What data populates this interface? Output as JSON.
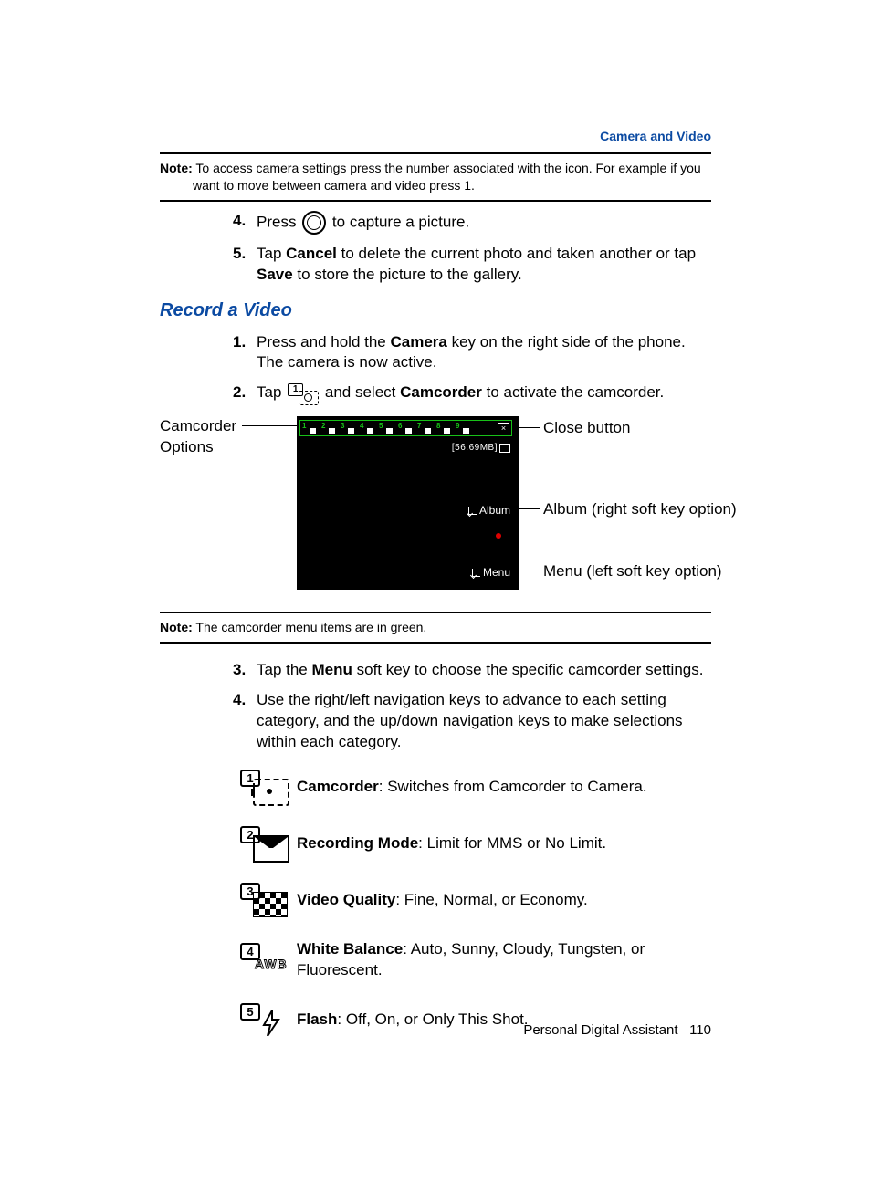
{
  "header": {
    "section": "Camera and Video"
  },
  "note1": {
    "label": "Note:",
    "text": "To access camera settings press the number associated with the icon. For example if you want to move between camera and video press 1."
  },
  "steps_a": {
    "s4": {
      "num": "4.",
      "pre": "Press ",
      "post": " to capture a picture."
    },
    "s5": {
      "num": "5.",
      "pre": "Tap ",
      "b1": "Cancel",
      "mid": " to delete the current photo and taken another or tap ",
      "b2": "Save",
      "post": " to store the picture to the gallery."
    }
  },
  "subhead": "Record a Video",
  "steps_b": {
    "s1": {
      "num": "1.",
      "pre": "Press and hold the ",
      "b1": "Camera",
      "post": " key on the right side of the phone. The camera is now active."
    },
    "s2": {
      "num": "2.",
      "pre": "Tap ",
      "mid": " and select ",
      "b1": "Camcorder",
      "post": " to activate the camcorder."
    }
  },
  "diagram": {
    "left_label_l1": "Camcorder",
    "left_label_l2": "Options",
    "storage": "[56.69MB]",
    "album": "Album",
    "menu": "Menu",
    "callout_close": "Close button",
    "callout_album": "Album (right soft key option)",
    "callout_menu": "Menu (left soft key option)",
    "toolbar_nums": [
      "1",
      "2",
      "3",
      "4",
      "5",
      "6",
      "7",
      "8",
      "9"
    ]
  },
  "note2": {
    "label": "Note:",
    "text": "The camcorder menu items are in green."
  },
  "steps_c": {
    "s3": {
      "num": "3.",
      "pre": "Tap the ",
      "b1": "Menu",
      "post": " soft key to choose the specific camcorder settings."
    },
    "s4": {
      "num": "4.",
      "text": "Use the right/left navigation keys to advance to each setting category, and the up/down navigation keys to make selections within each category."
    }
  },
  "iconlist": {
    "i1": {
      "key": "1",
      "name": "Camcorder",
      "desc": ": Switches from Camcorder to Camera."
    },
    "i2": {
      "key": "2",
      "name": "Recording Mode",
      "desc": ": Limit for MMS or No Limit."
    },
    "i3": {
      "key": "3",
      "name": "Video Quality",
      "desc": ": Fine, Normal, or Economy."
    },
    "i4": {
      "key": "4",
      "awb": "AWB",
      "name": "White Balance",
      "desc": ": Auto, Sunny, Cloudy, Tungsten, or Fluorescent."
    },
    "i5": {
      "key": "5",
      "name": "Flash",
      "desc": ": Off, On, or Only This Shot."
    }
  },
  "footer": {
    "title": "Personal Digital Assistant",
    "page": "110"
  }
}
